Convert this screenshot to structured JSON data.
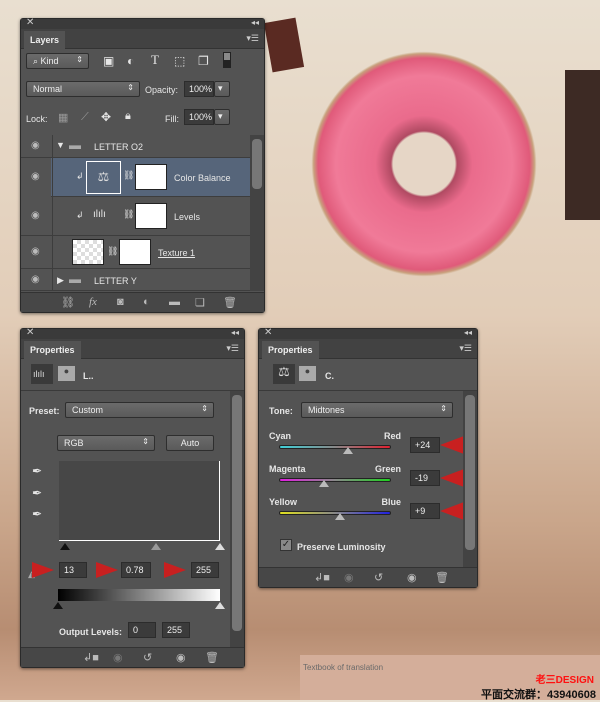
{
  "layers_panel": {
    "tab": "Layers",
    "filter_kind": "Kind",
    "blend_mode": "Normal",
    "opacity_label": "Opacity:",
    "opacity": "100%",
    "lock_label": "Lock:",
    "fill_label": "Fill:",
    "fill": "100%",
    "layers": [
      {
        "name": "LETTER O2",
        "type": "group",
        "expanded": true
      },
      {
        "name": "Color Balance",
        "type": "adjustment",
        "selected": true
      },
      {
        "name": "Levels",
        "type": "adjustment"
      },
      {
        "name": "Texture 1",
        "type": "pixel"
      },
      {
        "name": "LETTER Y",
        "type": "group",
        "expanded": false
      }
    ],
    "toolbar_fx": "fx"
  },
  "levels_props": {
    "tab": "Properties",
    "layer_short": "L..",
    "preset_label": "Preset:",
    "preset": "Custom",
    "channel": "RGB",
    "auto": "Auto",
    "input_black": "13",
    "input_mid": "0.78",
    "input_white": "255",
    "output_label": "Output Levels:",
    "output_black": "0",
    "output_white": "255"
  },
  "colorbalance_props": {
    "tab": "Properties",
    "layer_short": "C.",
    "tone_label": "Tone:",
    "tone": "Midtones",
    "sliders": [
      {
        "left": "Cyan",
        "right": "Red",
        "value": "+24",
        "num": 24
      },
      {
        "left": "Magenta",
        "right": "Green",
        "value": "-19",
        "num": -19
      },
      {
        "left": "Yellow",
        "right": "Blue",
        "value": "+9",
        "num": 9
      }
    ],
    "preserve_luminosity": "Preserve Luminosity",
    "preserve_checked": true
  },
  "watermark": {
    "caption": "Textbook of translation",
    "brand": "老三DESIGN",
    "group": "平面交流群：43940608"
  },
  "colors": {
    "panel": "#535353",
    "selected_row": "#56657a",
    "arrow": "#c82020",
    "brand": "#ff1010"
  }
}
